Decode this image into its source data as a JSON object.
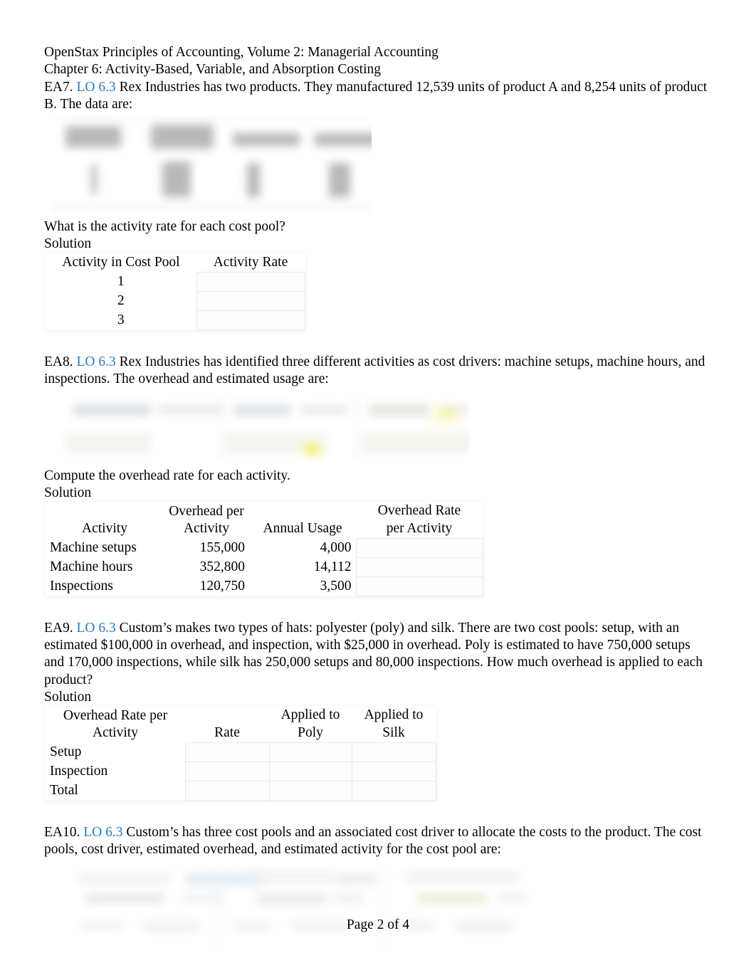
{
  "document": {
    "header_line1": "OpenStax Principles of Accounting, Volume 2: Managerial Accounting",
    "header_line2": "Chapter 6: Activity-Based, Variable, and Absorption Costing",
    "footer": "Page 2 of 4",
    "link_color": "#2a7ac0"
  },
  "problems": [
    {
      "id": "ea7",
      "number": "EA7.",
      "lo": "LO 6.3",
      "text": "Rex Industries has two products. They manufactured 12,539 units of product A and 8,254 units of product B. The data are:",
      "question": "What is the activity rate for each cost pool?",
      "solution_label": "Solution",
      "table": {
        "headers": [
          "Activity in Cost Pool",
          "Activity Rate"
        ],
        "rows": [
          {
            "pool": "1",
            "rate": ""
          },
          {
            "pool": "2",
            "rate": ""
          },
          {
            "pool": "3",
            "rate": ""
          }
        ]
      }
    },
    {
      "id": "ea8",
      "number": "EA8.",
      "lo": "LO 6.3",
      "text": "Rex Industries has identified three different activities as cost drivers: machine setups, machine hours, and inspections. The overhead and estimated usage are:",
      "question": "Compute the overhead rate for each activity.",
      "solution_label": "Solution",
      "table": {
        "headers": [
          "Activity",
          "Overhead per\nActivity",
          "Annual Usage",
          "Overhead Rate\nper Activity"
        ],
        "rows": [
          {
            "activity": "Machine setups",
            "overhead": "155,000",
            "usage": "4,000",
            "rate": ""
          },
          {
            "activity": "Machine hours",
            "overhead": "352,800",
            "usage": "14,112",
            "rate": ""
          },
          {
            "activity": "Inspections",
            "overhead": "120,750",
            "usage": "3,500",
            "rate": ""
          }
        ]
      }
    },
    {
      "id": "ea9",
      "number": "EA9.",
      "lo": "LO 6.3",
      "text": "Custom’s makes two types of hats: polyester (poly) and silk. There are two cost pools: setup, with an estimated $100,000 in overhead, and inspection, with $25,000 in overhead. Poly is estimated to have 750,000 setups and 170,000 inspections, while silk has 250,000 setups and 80,000 inspections. How much overhead is applied to each product?",
      "solution_label": "Solution",
      "table": {
        "headers": [
          "Overhead Rate per\nActivity",
          "Rate",
          "Applied to\nPoly",
          "Applied to\nSilk"
        ],
        "rows": [
          {
            "activity": "Setup",
            "rate": "",
            "poly": "",
            "silk": ""
          },
          {
            "activity": "Inspection",
            "rate": "",
            "poly": "",
            "silk": ""
          },
          {
            "activity": "Total",
            "rate": "",
            "poly": "",
            "silk": ""
          }
        ]
      }
    },
    {
      "id": "ea10",
      "number": "EA10.",
      "lo": "LO 6.3",
      "text": "Custom’s has three cost pools  and an associated cost driver to allocate the costs to the product. The cost pools, cost driver, estimated overhead, and estimated activity for the cost pool are:"
    }
  ]
}
